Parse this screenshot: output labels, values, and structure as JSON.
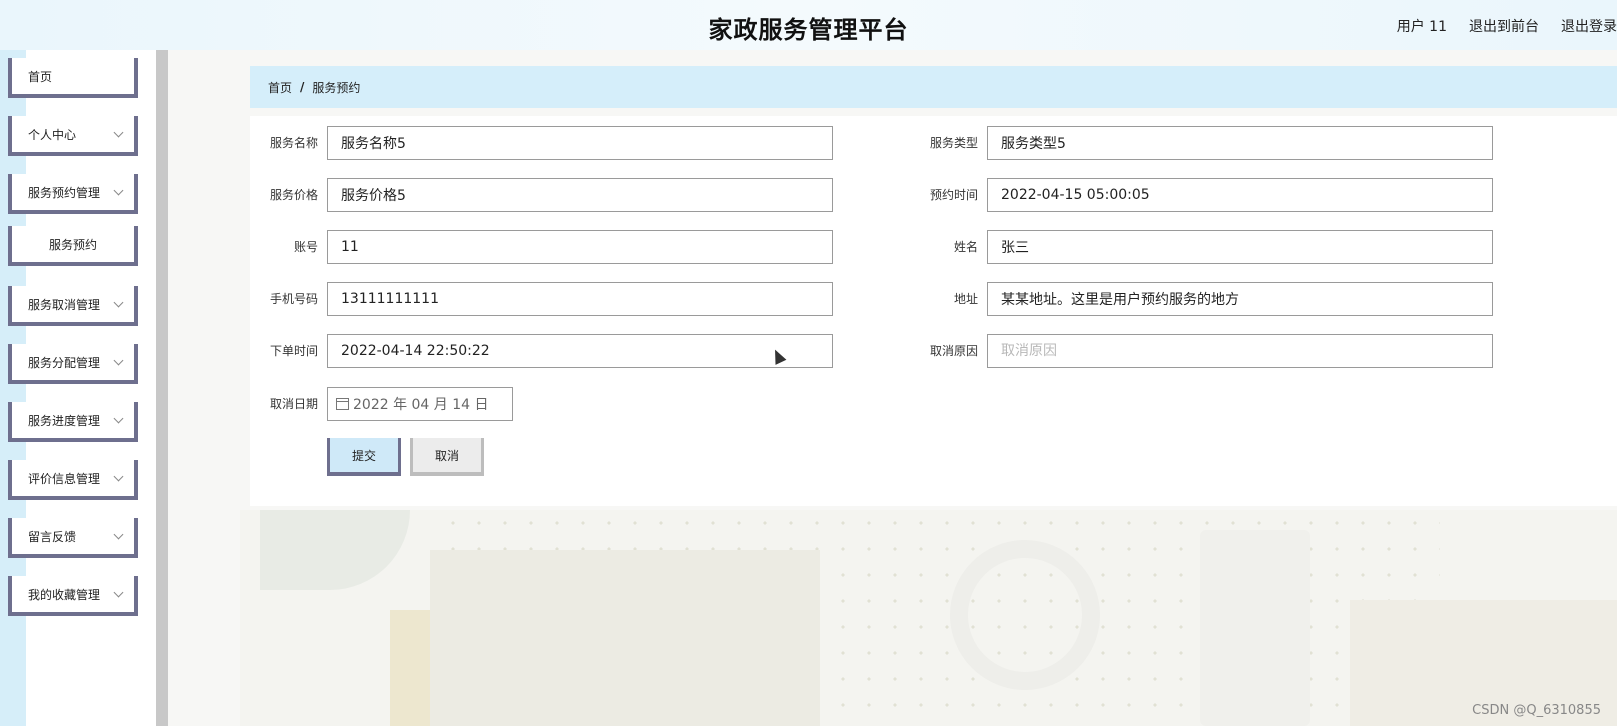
{
  "header": {
    "title": "家政服务管理平台",
    "user": "用户 11",
    "to_front": "退出到前台",
    "logout": "退出登录"
  },
  "sidebar": {
    "items": [
      {
        "label": "首页"
      },
      {
        "label": "个人中心"
      },
      {
        "label": "服务预约管理"
      },
      {
        "label": "服务预约"
      },
      {
        "label": "服务取消管理"
      },
      {
        "label": "服务分配管理"
      },
      {
        "label": "服务进度管理"
      },
      {
        "label": "评价信息管理"
      },
      {
        "label": "留言反馈"
      },
      {
        "label": "我的收藏管理"
      }
    ]
  },
  "breadcrumb": {
    "home": "首页",
    "separator": "/",
    "current": "服务预约"
  },
  "form": {
    "service_name": {
      "label": "服务名称",
      "value": "服务名称5"
    },
    "service_type": {
      "label": "服务类型",
      "value": "服务类型5"
    },
    "service_price": {
      "label": "服务价格",
      "value": "服务价格5"
    },
    "booking_time": {
      "label": "预约时间",
      "value": "2022-04-15 05:00:05"
    },
    "account": {
      "label": "账号",
      "value": "11"
    },
    "name": {
      "label": "姓名",
      "value": "张三"
    },
    "phone": {
      "label": "手机号码",
      "value": "13111111111"
    },
    "address": {
      "label": "地址",
      "value": "某某地址。这里是用户预约服务的地方"
    },
    "order_time": {
      "label": "下单时间",
      "value": "2022-04-14 22:50:22"
    },
    "cancel_reason": {
      "label": "取消原因",
      "value": "",
      "placeholder": "取消原因"
    },
    "cancel_date": {
      "label": "取消日期",
      "value": "2022 年 04 月 14 日"
    },
    "submit_label": "提交",
    "cancel_label": "取消"
  },
  "watermark": "CSDN @Q_6310855",
  "colors": {
    "accent": "#d5eefa",
    "nav_border": "#6e6f8e",
    "header_bg": "#eaf6fc"
  }
}
